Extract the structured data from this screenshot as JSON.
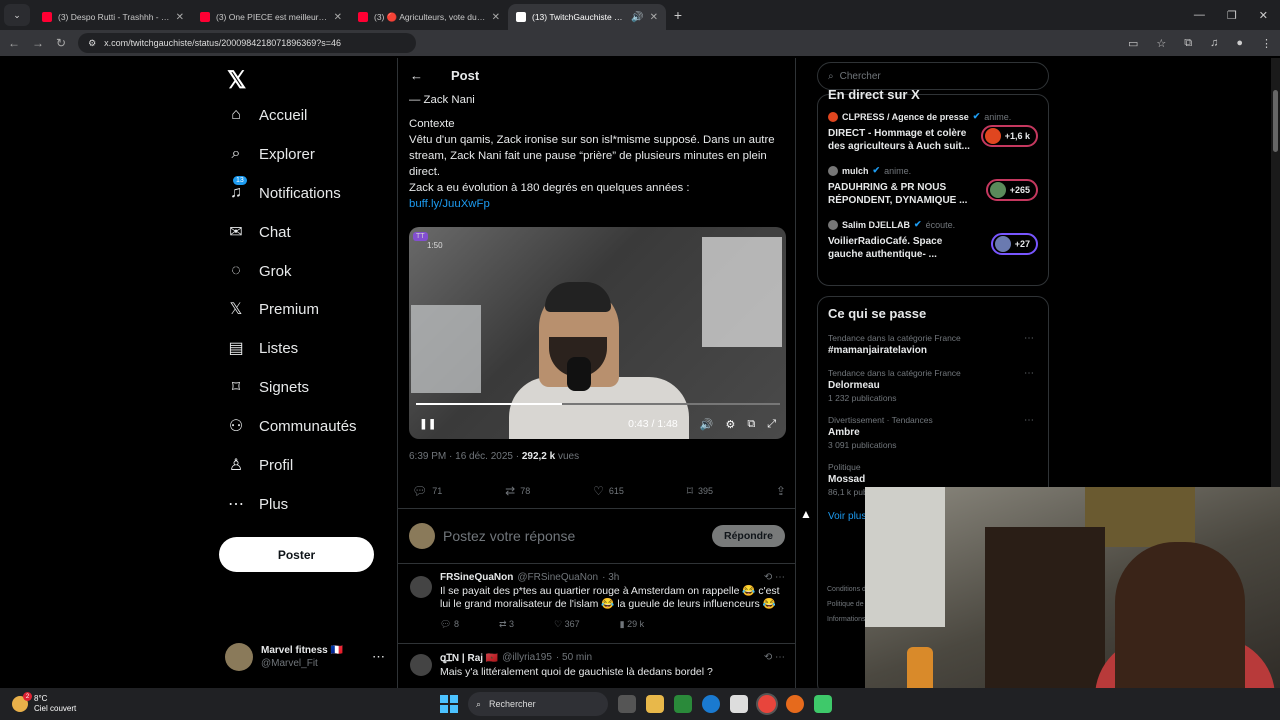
{
  "browser": {
    "tabs_menu": "⌄",
    "tabs": [
      {
        "title": "(3) Despo Rutti - Trashhh - YouTube",
        "favicon_color": "#ff0033",
        "active": false
      },
      {
        "title": "(3) One PIECE est meilleur sans",
        "favicon_color": "#ff0033",
        "active": false
      },
      {
        "title": "(3) 🔴 Agriculteurs, vote du bu",
        "favicon_color": "#ff0033",
        "active": false
      },
      {
        "title": "(13) TwitchGauchiste sur X",
        "favicon_color": "#ffffff",
        "active": true
      }
    ],
    "url": "x.com/twitchgauchiste/status/2000984218071896369?s=46"
  },
  "sidebar": {
    "logo": "𝕏",
    "nav": [
      {
        "label": "Accueil",
        "icon": "home-icon",
        "glyph": "⌂"
      },
      {
        "label": "Explorer",
        "icon": "search-icon",
        "glyph": "⌕"
      },
      {
        "label": "Notifications",
        "icon": "bell-icon",
        "glyph": "♪",
        "badge": "13"
      },
      {
        "label": "Chat",
        "icon": "mail-icon",
        "glyph": "✉"
      },
      {
        "label": "Grok",
        "icon": "grok-icon",
        "glyph": "◌"
      },
      {
        "label": "Premium",
        "icon": "x-icon",
        "glyph": "𝕏"
      },
      {
        "label": "Listes",
        "icon": "list-icon",
        "glyph": "▤"
      },
      {
        "label": "Signets",
        "icon": "bookmark-icon",
        "glyph": "⌑"
      },
      {
        "label": "Communautés",
        "icon": "community-icon",
        "glyph": "⚇"
      },
      {
        "label": "Profil",
        "icon": "profile-icon",
        "glyph": "♙"
      },
      {
        "label": "Plus",
        "icon": "more-icon",
        "glyph": "⋯"
      }
    ],
    "post_button": "Poster",
    "account": {
      "name": "Marvel fitness 🇫🇷",
      "handle": "@Marvel_Fit"
    }
  },
  "post": {
    "header": "Post",
    "text_author": "— Zack Nani",
    "context_label": "Contexte",
    "context_body": "Vêtu d'un qamis, Zack ironise sur son isl*misme supposé. Dans un autre stream, Zack Nani fait une pause “prière” de plusieurs minutes en plein direct.",
    "evolution": "Zack a eu évolution à 180 degrés en quelques années :",
    "link": "buff.ly/JuuXwFp",
    "video": {
      "current": "0:43",
      "total": "1:48",
      "progress": 0.4,
      "tag": "TT",
      "overlay_duration": "1:50"
    },
    "timestamp": "6:39 PM · 16 déc. 2025 · ",
    "views_count": "292,2 k",
    "views_label": " vues",
    "stats": {
      "replies": "71",
      "reposts": "78",
      "likes": "615",
      "bookmarks": "395"
    },
    "reply_placeholder": "Postez votre réponse",
    "reply_button": "Répondre"
  },
  "replies": [
    {
      "name": "FRSineQuaNon",
      "handle": "@FRSineQuaNon",
      "time": "· 3h",
      "text": "Il se payait des p*tes au quartier rouge à Amsterdam on rappelle 😂 c'est lui le grand moralisateur de l'islam 😂 la gueule de leurs influenceurs 😂",
      "replies": "8",
      "reposts": "3",
      "likes": "367",
      "views": "29 k"
    },
    {
      "name": "ꝗꞮN | Raj 🇲🇦",
      "handle": "@illyria195",
      "time": "· 50 min",
      "text": "Mais y'a littéralement quoi de gauchiste là dedans bordel ?"
    }
  ],
  "right": {
    "search_placeholder": "Chercher",
    "live_title": "En direct sur X",
    "spaces": [
      {
        "host": "CLPRESS / Agence de presse",
        "role": "anime.",
        "title": "DIRECT - Hommage et colère des agriculteurs à Auch suit...",
        "count": "+1,6 k",
        "color": "#e0461f"
      },
      {
        "host": "mulch",
        "role": "anime.",
        "title": "PADUHRING & PR NOUS RÉPONDENT, DYNAMIQUE ...",
        "count": "+265",
        "color": "#c5385f"
      },
      {
        "host": "Salim DJELLAB",
        "role": "écoute.",
        "title": "VoilierRadioCafé. Space gauche authentique- ...",
        "count": "+27",
        "color": "#7856ff"
      }
    ],
    "trends_title": "Ce qui se passe",
    "trends": [
      {
        "context": "Tendance dans la catégorie France",
        "title": "#mamanjairatelavion",
        "count": ""
      },
      {
        "context": "Tendance dans la catégorie France",
        "title": "Delormeau",
        "count": "1 232 publications"
      },
      {
        "context": "Divertissement · Tendances",
        "title": "Ambre",
        "count": "3 091 publications"
      },
      {
        "context": "Politique",
        "title": "Mossad",
        "count": "86,1 k publications"
      }
    ],
    "see_more": "Voir plus",
    "footer": [
      "Conditions d'utilisation",
      "Politique de confidentialité",
      "Informations"
    ]
  },
  "taskbar": {
    "temp": "8°C",
    "weather": "Ciel couvert",
    "weather_badge": "2",
    "search": "Rechercher"
  }
}
